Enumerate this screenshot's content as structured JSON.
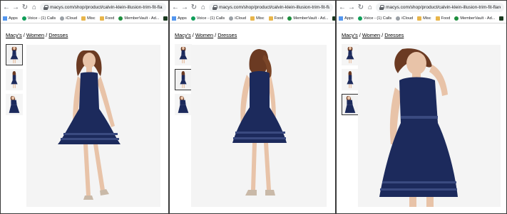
{
  "panels": [
    {
      "url": "macys.com/shop/product/calvin-klein-illusion-trim-fit-flare-dress",
      "bookmarks": [
        "Apps",
        "Voice - (1) Calls",
        "iCloud",
        "Misc",
        "Food",
        "MemberVault - Ad..."
      ],
      "breadcrumb": [
        "Macy's",
        "Women",
        "Dresses"
      ],
      "selected_thumb": 0
    },
    {
      "url": "macys.com/shop/product/calvin-klein-illusion-trim-fit-flare-dress",
      "bookmarks": [
        "Apps",
        "Voice - (1) Calls",
        "iCloud",
        "Misc",
        "Food",
        "MemberVault - Ad..."
      ],
      "breadcrumb": [
        "Macy's",
        "Women",
        "Dresses"
      ],
      "selected_thumb": 1
    },
    {
      "url": "macys.com/shop/product/calvin-klein-illusion-trim-fit-flare-dress",
      "bookmarks": [
        "Apps",
        "Voice - (1) Calls",
        "iCloud",
        "Misc",
        "Food",
        "MemberVault - Ad..."
      ],
      "breadcrumb": [
        "Macy's",
        "Women",
        "Dresses"
      ],
      "selected_thumb": 2
    }
  ],
  "breadcrumb_separator": "/",
  "colors": {
    "dress": "#1c2a5c",
    "dress_shade": "#141f47",
    "skin": "#e8c3a8",
    "hair": "#6b3a22",
    "photo_bg": "#f4f4f4",
    "omnibox": "#f1f3f4"
  },
  "icons": {
    "back": "arrow-left-icon",
    "forward": "arrow-right-icon",
    "reload": "reload-icon",
    "home": "home-icon",
    "lock": "lock-icon",
    "apps": "apps-grid-icon",
    "extension": "extension-icon"
  }
}
